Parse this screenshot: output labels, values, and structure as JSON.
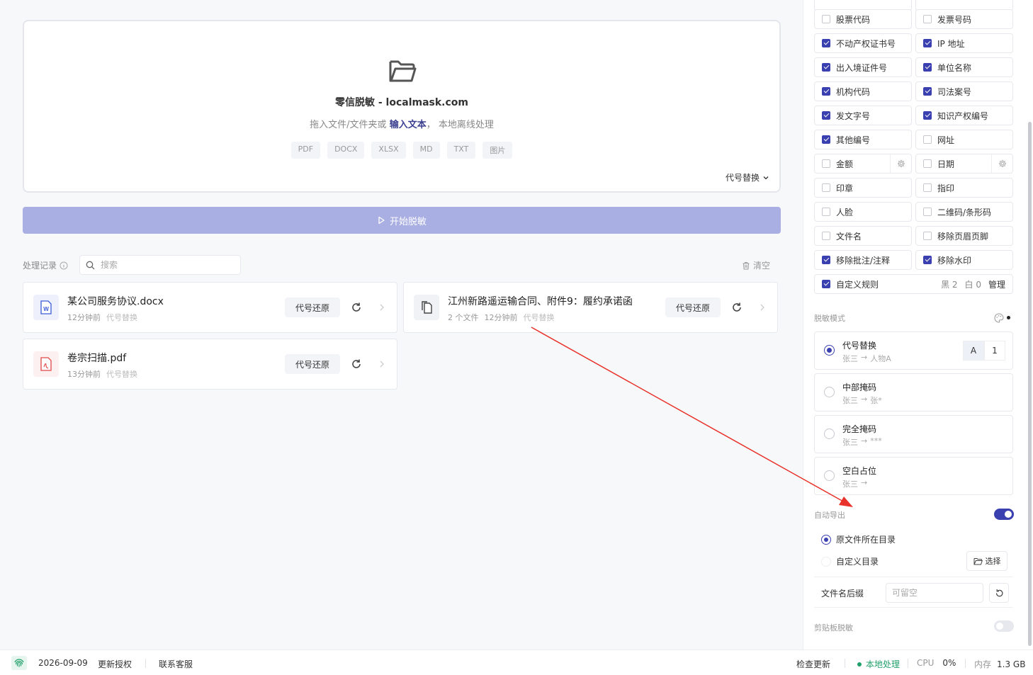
{
  "dropzone": {
    "title": "零信脱敏 - localmask.com",
    "sub_prefix": "拖入文件/文件夹或",
    "sub_link": "输入文本",
    "sub_suffix": "， 本地离线处理",
    "formats": [
      "PDF",
      "DOCX",
      "XLSX",
      "MD",
      "TXT",
      "图片"
    ],
    "mode_label": "代号替换"
  },
  "start_button": "开始脱敏",
  "history": {
    "label": "处理记录",
    "search_placeholder": "搜索",
    "clear_label": "清空",
    "items": [
      {
        "name": "某公司服务协议.docx",
        "count": "",
        "time": "12分钟前",
        "mode": "代号替换",
        "restore": "代号还原",
        "icon": "word-file-icon"
      },
      {
        "name": "江州新路遥运输合同、附件9：履约承诺函",
        "count": "2 个文件",
        "time": "12分钟前",
        "mode": "代号替换",
        "restore": "代号还原",
        "icon": "multi-file-icon"
      },
      {
        "name": "卷宗扫描.pdf",
        "count": "",
        "time": "13分钟前",
        "mode": "代号替换",
        "restore": "代号还原",
        "icon": "pdf-file-icon"
      }
    ]
  },
  "options": [
    {
      "label": "股票代码",
      "checked": false
    },
    {
      "label": "发票号码",
      "checked": false
    },
    {
      "label": "不动产权证书号",
      "checked": true
    },
    {
      "label": "IP 地址",
      "checked": true
    },
    {
      "label": "出入境证件号",
      "checked": true
    },
    {
      "label": "单位名称",
      "checked": true
    },
    {
      "label": "机构代码",
      "checked": true
    },
    {
      "label": "司法案号",
      "checked": true
    },
    {
      "label": "发文字号",
      "checked": true
    },
    {
      "label": "知识产权编号",
      "checked": true
    },
    {
      "label": "其他编号",
      "checked": true
    },
    {
      "label": "网址",
      "checked": false
    },
    {
      "label": "金额",
      "checked": false
    },
    {
      "label": "日期",
      "checked": false
    },
    {
      "label": "印章",
      "checked": false
    },
    {
      "label": "指印",
      "checked": false
    },
    {
      "label": "人脸",
      "checked": false
    },
    {
      "label": "二维码/条形码",
      "checked": false
    },
    {
      "label": "文件名",
      "checked": false
    },
    {
      "label": "移除页眉页脚",
      "checked": false
    },
    {
      "label": "移除批注/注释",
      "checked": true
    },
    {
      "label": "移除水印",
      "checked": true
    }
  ],
  "custom_rules": {
    "label": "自定义规则",
    "checked": true,
    "black": "黑 2",
    "white": "白 0",
    "manage": "管理"
  },
  "mask_mode": {
    "label": "脱敏模式",
    "modes": [
      {
        "name": "代号替换",
        "from": "张三",
        "to": "人物A",
        "selected": true
      },
      {
        "name": "中部掩码",
        "from": "张三",
        "to": "张*",
        "selected": false
      },
      {
        "name": "完全掩码",
        "from": "张三",
        "to": "***",
        "selected": false
      },
      {
        "name": "空白占位",
        "from": "张三",
        "to": "",
        "selected": false
      }
    ],
    "style_options": [
      "A",
      "1"
    ]
  },
  "auto_export": {
    "label": "自动导出",
    "enabled": true,
    "option_source": "原文件所在目录",
    "option_custom": "自定义目录",
    "pick_label": "选择",
    "suffix_label": "文件名后缀",
    "suffix_placeholder": "可留空"
  },
  "clipboard": {
    "label": "剪贴板脱敏",
    "enabled": false
  },
  "statusbar": {
    "date": "2026-09-09",
    "license": "更新授权",
    "support": "联系客服",
    "check_update": "检查更新",
    "local": "本地处理",
    "cpu_label": "CPU",
    "cpu_value": "0%",
    "mem_label": "内存",
    "mem_value": "1.3 GB"
  },
  "colors": {
    "accent": "#3b40b0",
    "start_button": "#a9aee3",
    "annotation_arrow": "#e8322a",
    "status_ok": "#22a06b"
  }
}
